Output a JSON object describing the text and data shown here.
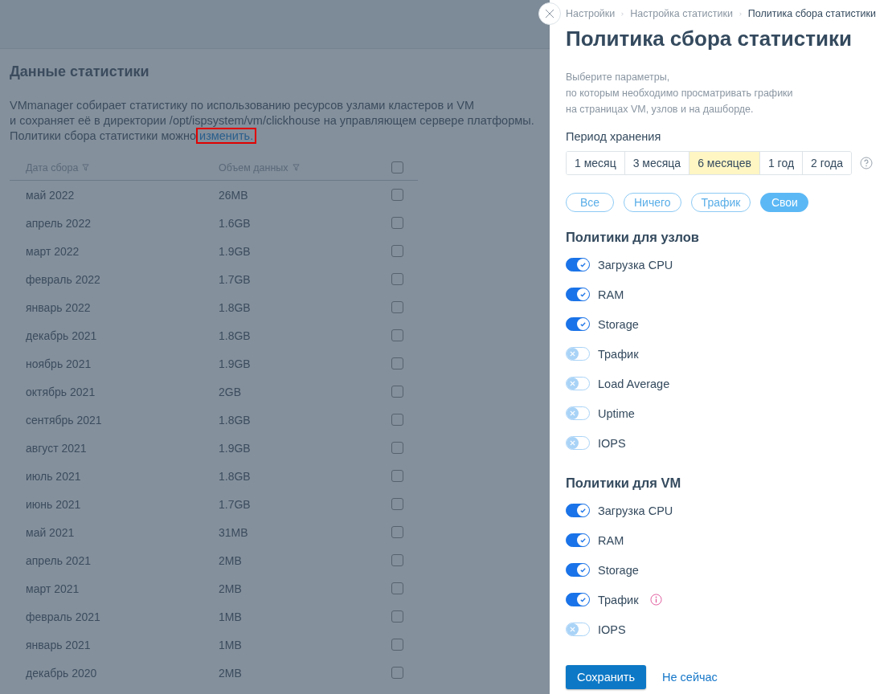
{
  "page": {
    "title": "Данные статистики",
    "description": [
      "VMmanager собирает статистику по использованию ресурсов узлами кластеров и VM",
      "и сохраняет её в директории /opt/ispsystem/vm/clickhouse на управляющем сервере платформы."
    ],
    "policy_note": {
      "text": "Политики сбора статистики можно",
      "link": "изменить.",
      "link_highlighted": true
    }
  },
  "table": {
    "columns": [
      {
        "label": "Дата сбора"
      },
      {
        "label": "Объем данных"
      }
    ],
    "select_all_checked": false,
    "rows": [
      {
        "date": "май 2022",
        "size": "26MB",
        "checked": false
      },
      {
        "date": "апрель 2022",
        "size": "1.6GB",
        "checked": false
      },
      {
        "date": "март 2022",
        "size": "1.9GB",
        "checked": false
      },
      {
        "date": "февраль 2022",
        "size": "1.7GB",
        "checked": false
      },
      {
        "date": "январь 2022",
        "size": "1.8GB",
        "checked": false
      },
      {
        "date": "декабрь 2021",
        "size": "1.8GB",
        "checked": false
      },
      {
        "date": "ноябрь 2021",
        "size": "1.9GB",
        "checked": false
      },
      {
        "date": "октябрь 2021",
        "size": "2GB",
        "checked": false
      },
      {
        "date": "сентябрь 2021",
        "size": "1.8GB",
        "checked": false
      },
      {
        "date": "август 2021",
        "size": "1.9GB",
        "checked": false
      },
      {
        "date": "июль 2021",
        "size": "1.8GB",
        "checked": false
      },
      {
        "date": "июнь 2021",
        "size": "1.7GB",
        "checked": false
      },
      {
        "date": "май 2021",
        "size": "31MB",
        "checked": false
      },
      {
        "date": "апрель 2021",
        "size": "2MB",
        "checked": false
      },
      {
        "date": "март 2021",
        "size": "2MB",
        "checked": false
      },
      {
        "date": "февраль 2021",
        "size": "1MB",
        "checked": false
      },
      {
        "date": "январь 2021",
        "size": "1MB",
        "checked": false
      },
      {
        "date": "декабрь 2020",
        "size": "2MB",
        "checked": false
      }
    ]
  },
  "panel": {
    "breadcrumbs": [
      {
        "label": "Настройки",
        "current": false
      },
      {
        "label": "Настройка статистики",
        "current": false
      },
      {
        "label": "Политика сбора статистики",
        "current": true
      }
    ],
    "title": "Политика сбора статистики",
    "description": [
      "Выберите параметры,",
      "по которым необходимо просматривать графики",
      "на страницах VM, узлов и на дашборде."
    ],
    "retention": {
      "label": "Период хранения",
      "options": [
        {
          "label": "1 месяц",
          "selected": false
        },
        {
          "label": "3 месяца",
          "selected": false
        },
        {
          "label": "6 месяцев",
          "selected": true
        },
        {
          "label": "1 год",
          "selected": false
        },
        {
          "label": "2 года",
          "selected": false
        }
      ]
    },
    "presets": [
      {
        "label": "Все",
        "selected": false
      },
      {
        "label": "Ничего",
        "selected": false
      },
      {
        "label": "Трафик",
        "selected": false
      },
      {
        "label": "Свои",
        "selected": true
      }
    ],
    "sections": [
      {
        "title": "Политики для узлов",
        "items": [
          {
            "label": "Загрузка CPU",
            "on": true,
            "info": false
          },
          {
            "label": "RAM",
            "on": true,
            "info": false
          },
          {
            "label": "Storage",
            "on": true,
            "info": false
          },
          {
            "label": "Трафик",
            "on": false,
            "info": false
          },
          {
            "label": "Load Average",
            "on": false,
            "info": false
          },
          {
            "label": "Uptime",
            "on": false,
            "info": false
          },
          {
            "label": "IOPS",
            "on": false,
            "info": false
          }
        ]
      },
      {
        "title": "Политики для VM",
        "items": [
          {
            "label": "Загрузка CPU",
            "on": true,
            "info": false
          },
          {
            "label": "RAM",
            "on": true,
            "info": false
          },
          {
            "label": "Storage",
            "on": true,
            "info": false
          },
          {
            "label": "Трафик",
            "on": true,
            "info": true
          },
          {
            "label": "IOPS",
            "on": false,
            "info": false
          }
        ]
      }
    ],
    "buttons": {
      "save": "Сохранить",
      "cancel": "Не сейчас"
    }
  }
}
